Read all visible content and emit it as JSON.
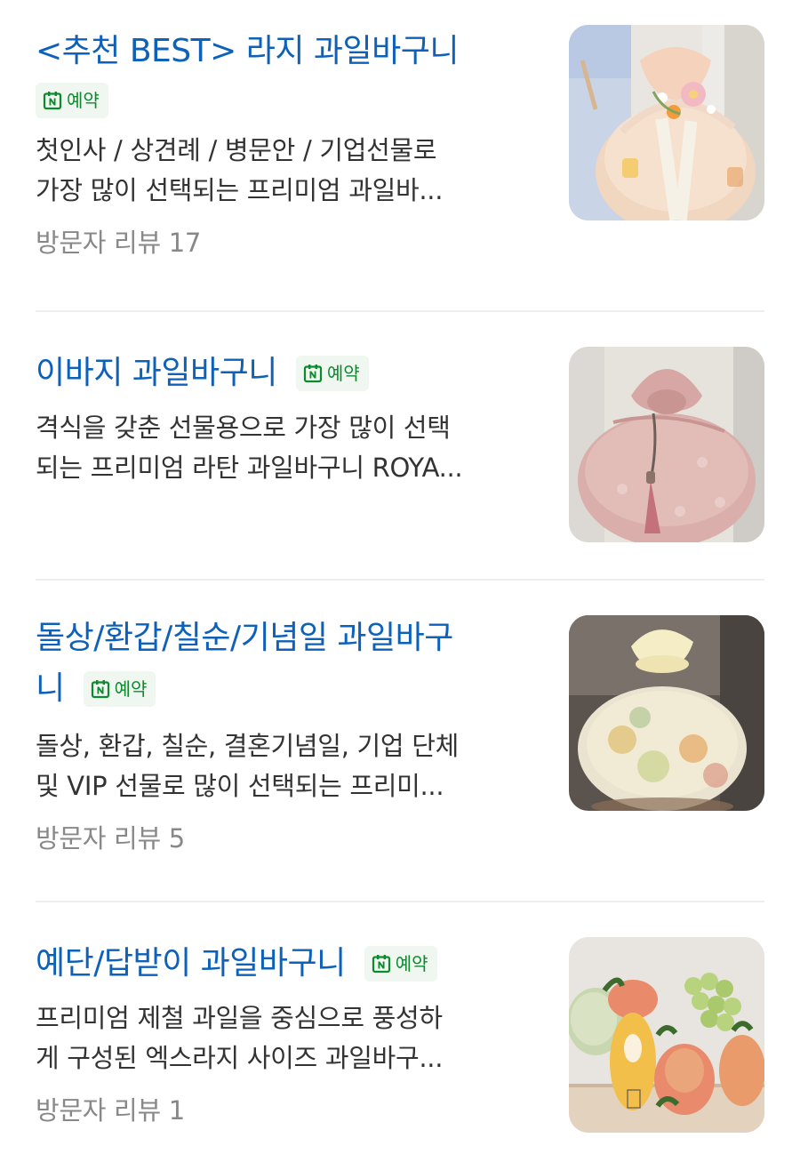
{
  "items": [
    {
      "title": "<추천 BEST> 라지 과일바구니",
      "badge": "예약",
      "desc_lines": [
        "첫인사 / 상견례 / 병문안 / 기업선물로",
        "가장 많이 선택되는 프리미엄 과일바..."
      ],
      "review": "방문자 리뷰 17",
      "image": "fruit-basket-wrapped-peach-ribbon"
    },
    {
      "title": "이바지 과일바구니",
      "badge": "예약",
      "desc_lines": [
        "격식을 갖춘 선물용으로 가장 많이 선택",
        "되는 프리미엄 라탄 과일바구니 ROYA..."
      ],
      "review": "",
      "image": "fruit-basket-wrapped-pink-silk"
    },
    {
      "title_lines": [
        "돌상/환갑/칠순/기념일 과일바구",
        "니"
      ],
      "badge": "예약",
      "desc_lines": [
        "돌상, 환갑, 칠순, 결혼기념일, 기업 단체",
        "및 VIP 선물로 많이 선택되는 프리미..."
      ],
      "review": "방문자 리뷰 5",
      "image": "fruit-basket-wrapped-sheer-organza"
    },
    {
      "title": "예단/답받이 과일바구니",
      "badge": "예약",
      "desc_lines": [
        "프리미엄 제철 과일을 중심으로 풍성하",
        "게 구성된 엑스라지 사이즈 과일바구..."
      ],
      "review": "방문자 리뷰 1",
      "image": "fruit-box-mango-grapes-melon"
    }
  ],
  "colors": {
    "title": "#0e61b9",
    "badge_text": "#0d8a2e",
    "badge_bg": "#eff7f0",
    "review": "#888888",
    "divider": "#eeeeee"
  }
}
